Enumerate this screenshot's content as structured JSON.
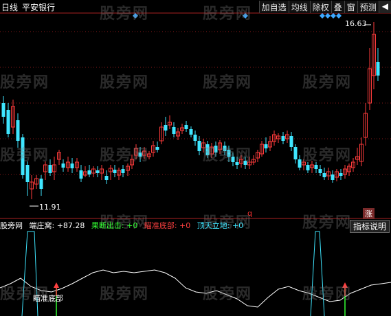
{
  "header": {
    "period": "日线",
    "stock_name": "平安银行"
  },
  "toolbar": {
    "buttons": [
      "加自选",
      "均线",
      "除权",
      "叠",
      "窗",
      "预测"
    ],
    "arrow_icon": "arrow-left-icon"
  },
  "watermark": "股旁网",
  "main_chart": {
    "high_label": "16.63",
    "low_label": "11.91",
    "zhang_badge": "涨",
    "q_mark": "q",
    "up_color": "#ff3b3b",
    "down_color": "#3fe6ff",
    "grid_color": "#8a1a1a"
  },
  "indicator": {
    "name": "股旁网",
    "items": [
      {
        "label": "端庄窝: +87.28",
        "color": "#ffffff"
      },
      {
        "label": "果断出击: +0",
        "color": "#33ff33"
      },
      {
        "label": "瞄准底部: +0",
        "color": "#ff4040"
      },
      {
        "label": "顶天立地: +0",
        "color": "#3fe6ff"
      }
    ],
    "button_label": "指标说明",
    "annotation": "瞄准底部"
  }
}
